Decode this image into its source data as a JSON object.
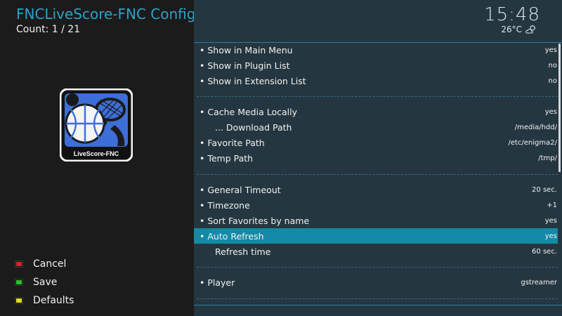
{
  "header": {
    "title": "FNCLiveScore-FNC Config",
    "count": "Count: 1 / 21"
  },
  "logo": {
    "caption": "LiveScore-FNC"
  },
  "keys": [
    {
      "label": "Cancel",
      "color": "#d0262a"
    },
    {
      "label": "Save",
      "color": "#27c427"
    },
    {
      "label": "Defaults",
      "color": "#e2dd23"
    }
  ],
  "clock": {
    "time": "15:48",
    "temperature": "26°C",
    "weather_icon": "partly-cloudy-icon"
  },
  "settings": [
    {
      "label": "• Show in Main Menu",
      "value": "yes"
    },
    {
      "label": "• Show in Plugin List",
      "value": "no"
    },
    {
      "label": "• Show in Extension List",
      "value": "no"
    },
    {
      "label": "• Cache Media Locally",
      "value": "yes"
    },
    {
      "label": "... Download Path",
      "value": "/media/hdd/"
    },
    {
      "label": "• Favorite Path",
      "value": "/etc/enigma2/"
    },
    {
      "label": "• Temp Path",
      "value": "/tmp/"
    },
    {
      "label": "• General Timeout",
      "value": "20 sec."
    },
    {
      "label": "• Timezone",
      "value": "+1"
    },
    {
      "label": "• Sort Favorites by name",
      "value": "yes"
    },
    {
      "label": "• Auto Refresh",
      "value": "yes",
      "selected": true
    },
    {
      "label": "Refresh time",
      "value": "60 sec."
    },
    {
      "label": "• Player",
      "value": "gstreamer"
    }
  ],
  "colors": {
    "accent": "#2aa3c8",
    "selected_row": "#138aa6",
    "list_bg": "#243640",
    "side_bg": "#1b1b1b"
  }
}
